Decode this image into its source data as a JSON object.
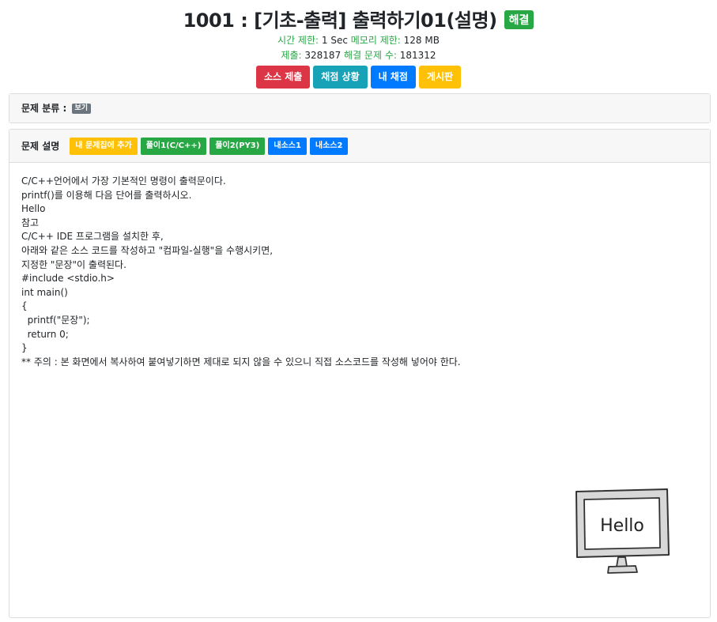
{
  "header": {
    "title": "1001 : [기초-출력] 출력하기01(설명)",
    "solved_badge": "해결"
  },
  "meta": {
    "time_limit_label": "시간 제한:",
    "time_limit_value": "1 Sec",
    "memory_limit_label": "메모리 제한:",
    "memory_limit_value": "128 MB",
    "submissions_label": "제출:",
    "submissions_value": "328187",
    "solved_count_label": "해결 문제 수:",
    "solved_count_value": "181312"
  },
  "actions": {
    "submit_source": "소스 제출",
    "judge_status": "채점 상황",
    "my_judge": "내 채점",
    "board": "게시판"
  },
  "category": {
    "label": "문제 분류 :",
    "view": "보기"
  },
  "description": {
    "title": "문제 설명",
    "buttons": {
      "add_to_mine": "내 문제집에 추가",
      "solution1": "풀이1(C/C++)",
      "solution2": "풀이2(PY3)",
      "my_source1": "내소스1",
      "my_source2": "내소스2"
    },
    "lines": [
      "C/C++언어에서 가장 기본적인 명령이 출력문이다.",
      "printf()를 이용해 다음 단어를 출력하시오.",
      "",
      "Hello",
      "",
      "참고",
      "C/C++ IDE 프로그램을 설치한 후,",
      "아래와 같은 소스 코드를 작성하고 \"컴파일-실행\"을 수행시키면,",
      "지정한 \"문장\"이 출력된다.",
      "",
      "#include <stdio.h>",
      "",
      "int main()",
      "{",
      "  printf(\"문장\");",
      "  return 0;",
      "}",
      "",
      "** 주의 : 본 화면에서 복사하여 붙여넣기하면 제대로 되지 않을 수 있으니 직접 소스코드를 작성해 넣어야 한다."
    ],
    "image_text": "Hello"
  },
  "colors": {
    "green": "#28a745",
    "red": "#dc3545",
    "teal": "#17a2b8",
    "blue": "#007bff",
    "yellow": "#ffc107",
    "gray": "#6c757d"
  }
}
